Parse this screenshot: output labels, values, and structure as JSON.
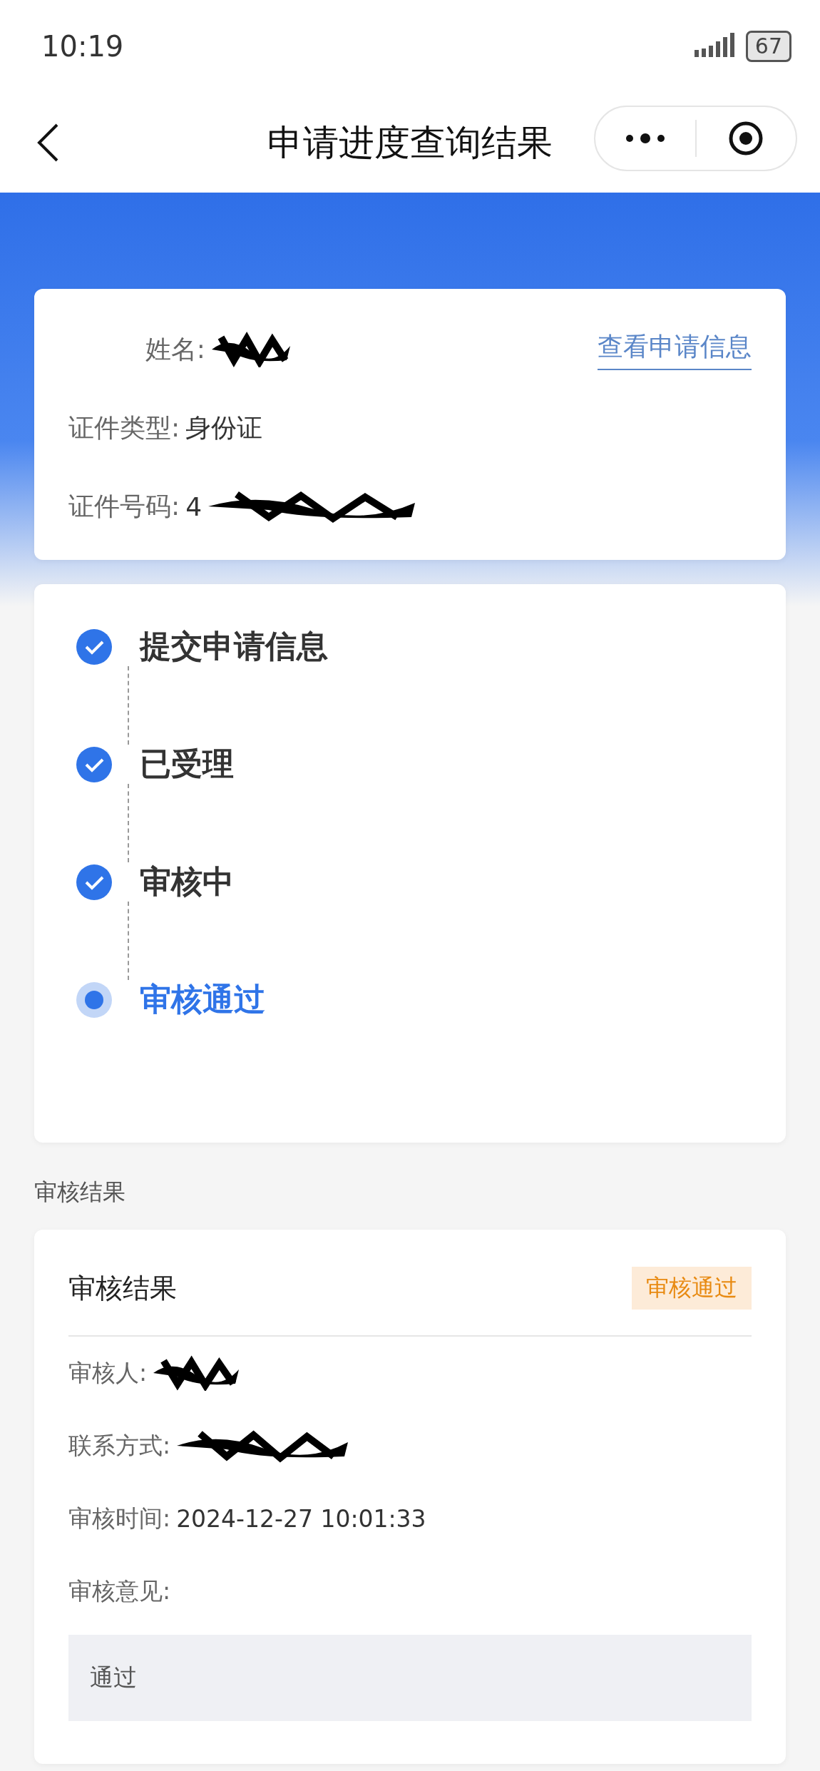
{
  "status_bar": {
    "time": "10:19",
    "battery": "67"
  },
  "nav": {
    "title": "申请进度查询结果"
  },
  "applicant": {
    "link": "查看申请信息",
    "fields": [
      {
        "label": "姓名:",
        "redacted": true
      },
      {
        "label": "证件类型:",
        "value": "身份证",
        "redacted": false
      },
      {
        "label": "证件号码:",
        "value": "4",
        "redacted": true
      }
    ]
  },
  "steps": [
    {
      "label": "提交申请信息",
      "done": true
    },
    {
      "label": "已受理",
      "done": true
    },
    {
      "label": "审核中",
      "done": true
    },
    {
      "label": "审核通过",
      "done": false
    }
  ],
  "section_label": "审核结果",
  "result": {
    "title": "审核结果",
    "badge": "审核通过",
    "fields": [
      {
        "label": "审核人:",
        "redacted": true
      },
      {
        "label": "联系方式:",
        "redacted": true
      },
      {
        "label": "审核时间:",
        "value": "2024-12-27 10:01:33",
        "redacted": false
      },
      {
        "label": "审核意见:",
        "redacted": false
      }
    ],
    "opinion": "通过"
  }
}
